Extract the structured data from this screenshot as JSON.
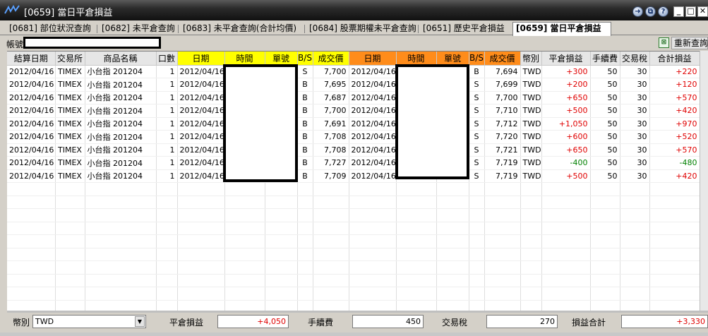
{
  "window": {
    "title": "[0659] 當日平倉損益"
  },
  "tabs": [
    {
      "label": "[0681] 部位狀況查詢"
    },
    {
      "label": "[0682] 未平倉查詢"
    },
    {
      "label": "[0683] 未平倉查詢(合計均價)"
    },
    {
      "label": "[0684] 股票期權未平倉查詢"
    },
    {
      "label": "[0651] 歷史平倉損益"
    },
    {
      "label": "[0659] 當日平倉損益"
    }
  ],
  "account": {
    "label": "帳號",
    "value": ""
  },
  "toolbar": {
    "refresh_label": "重新查詢"
  },
  "table": {
    "headers": [
      "結算日期",
      "交易所",
      "商品名稱",
      "口數",
      "日期",
      "時間",
      "單號",
      "B/S",
      "成交價",
      "日期",
      "時間",
      "單號",
      "B/S",
      "成交價",
      "幣別",
      "平倉損益",
      "手續費",
      "交易稅",
      "合計損益"
    ],
    "rows": [
      [
        "2012/04/16",
        "TIMEX",
        "小台指 201204",
        "1",
        "2012/04/16",
        "",
        "",
        "S",
        "7,700",
        "2012/04/16",
        "",
        "",
        "B",
        "7,694",
        "TWD",
        "+300",
        "50",
        "30",
        "+220"
      ],
      [
        "2012/04/16",
        "TIMEX",
        "小台指 201204",
        "1",
        "2012/04/16",
        "",
        "",
        "B",
        "7,695",
        "2012/04/16",
        "",
        "",
        "S",
        "7,699",
        "TWD",
        "+200",
        "50",
        "30",
        "+120"
      ],
      [
        "2012/04/16",
        "TIMEX",
        "小台指 201204",
        "1",
        "2012/04/16",
        "",
        "",
        "B",
        "7,687",
        "2012/04/16",
        "",
        "",
        "S",
        "7,700",
        "TWD",
        "+650",
        "50",
        "30",
        "+570"
      ],
      [
        "2012/04/16",
        "TIMEX",
        "小台指 201204",
        "1",
        "2012/04/16",
        "",
        "",
        "B",
        "7,700",
        "2012/04/16",
        "",
        "",
        "S",
        "7,710",
        "TWD",
        "+500",
        "50",
        "30",
        "+420"
      ],
      [
        "2012/04/16",
        "TIMEX",
        "小台指 201204",
        "1",
        "2012/04/16",
        "",
        "",
        "B",
        "7,691",
        "2012/04/16",
        "",
        "",
        "S",
        "7,712",
        "TWD",
        "+1,050",
        "50",
        "30",
        "+970"
      ],
      [
        "2012/04/16",
        "TIMEX",
        "小台指 201204",
        "1",
        "2012/04/16",
        "",
        "",
        "B",
        "7,708",
        "2012/04/16",
        "",
        "",
        "S",
        "7,720",
        "TWD",
        "+600",
        "50",
        "30",
        "+520"
      ],
      [
        "2012/04/16",
        "TIMEX",
        "小台指 201204",
        "1",
        "2012/04/16",
        "",
        "",
        "B",
        "7,708",
        "2012/04/16",
        "",
        "",
        "S",
        "7,721",
        "TWD",
        "+650",
        "50",
        "30",
        "+570"
      ],
      [
        "2012/04/16",
        "TIMEX",
        "小台指 201204",
        "1",
        "2012/04/16",
        "",
        "",
        "B",
        "7,727",
        "2012/04/16",
        "",
        "",
        "S",
        "7,719",
        "TWD",
        "-400",
        "50",
        "30",
        "-480"
      ],
      [
        "2012/04/16",
        "TIMEX",
        "小台指 201204",
        "1",
        "2012/04/16",
        "",
        "",
        "B",
        "7,709",
        "2012/04/16",
        "",
        "",
        "S",
        "7,719",
        "TWD",
        "+500",
        "50",
        "30",
        "+420"
      ]
    ]
  },
  "footer": {
    "currency_label": "幣別",
    "currency_value": "TWD",
    "close_pnl_label": "平倉損益",
    "close_pnl_value": "+4,050",
    "fee_label": "手續費",
    "fee_value": "450",
    "tax_label": "交易稅",
    "tax_value": "270",
    "total_label": "損益合計",
    "total_value": "+3,330"
  },
  "colors": {
    "open_header": "#ffff00",
    "close_header": "#ff8c1a",
    "profit": "#e00000",
    "loss": "#008000"
  },
  "icons": [
    "app-logo-icon",
    "pin-icon",
    "restore-window-icon",
    "help-icon",
    "minimize-icon",
    "maximize-icon",
    "close-icon",
    "refresh-icon",
    "dropdown-arrow-icon"
  ]
}
